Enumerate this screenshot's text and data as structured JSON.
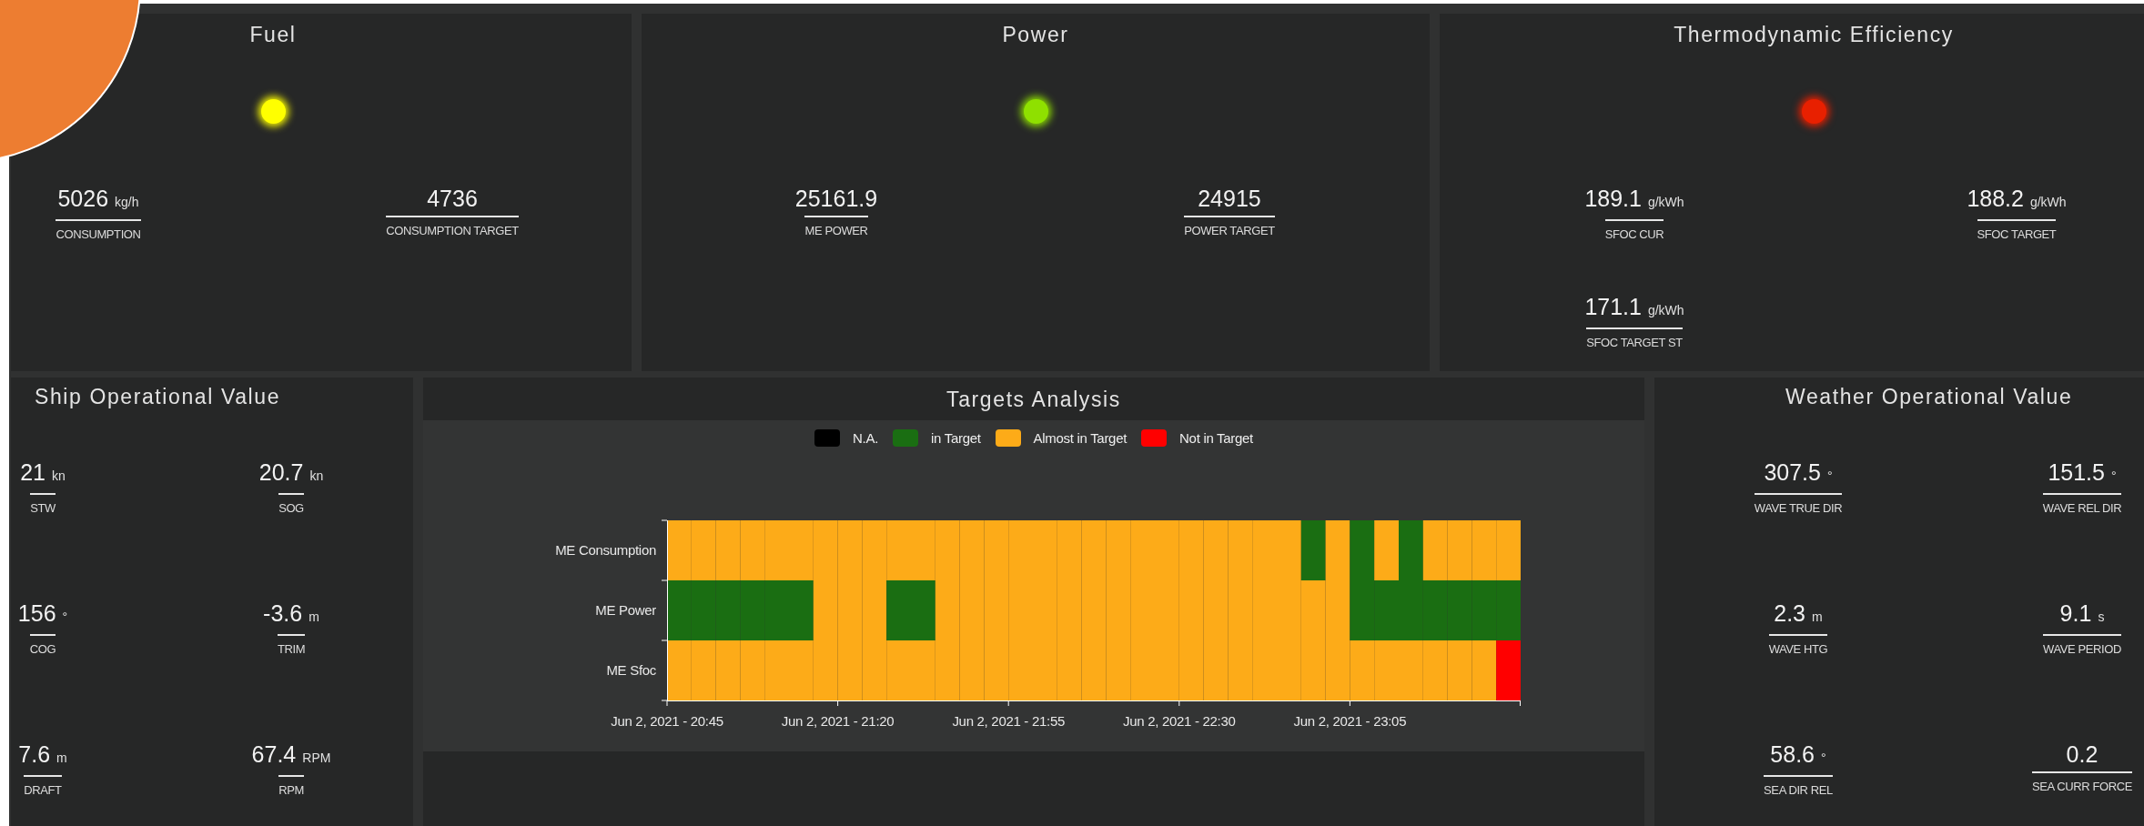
{
  "top_panels": [
    {
      "kind": "fuel",
      "title": "Fuel",
      "lamp": {
        "color": "#ffff00"
      },
      "metrics": [
        {
          "value": "5026",
          "unit": "kg/h",
          "label": "CONSUMPTION"
        },
        {
          "value": "4736",
          "label": "CONSUMPTION TARGET"
        }
      ]
    },
    {
      "kind": "power",
      "title": "Power",
      "lamp": {
        "color": "#8fe000"
      },
      "metrics": [
        {
          "value": "25161.9",
          "label": "ME POWER"
        },
        {
          "value": "24915",
          "label": "POWER TARGET"
        }
      ]
    },
    {
      "kind": "thermo",
      "title": "Thermodynamic Efficiency",
      "lamp": {
        "color": "#e82000"
      },
      "metrics": [
        {
          "value": "189.1",
          "unit": "g/kWh",
          "label": "SFOC CUR"
        },
        {
          "value": "188.2",
          "unit": "g/kWh",
          "label": "SFOC TARGET"
        },
        {
          "value": "171.1",
          "unit": "g/kWh",
          "label": "SFOC TARGET ST"
        }
      ]
    }
  ],
  "ship_operational": {
    "title": "Ship Operational Value",
    "metrics": [
      {
        "value": "21",
        "unit": "kn",
        "label": "STW"
      },
      {
        "value": "20.7",
        "unit": "kn",
        "label": "SOG"
      },
      {
        "value": "156",
        "unit": "°",
        "label": "COG"
      },
      {
        "value": "-3.6",
        "unit": "m",
        "label": "TRIM"
      },
      {
        "value": "7.6",
        "unit": "m",
        "label": "DRAFT"
      },
      {
        "value": "67.4",
        "unit": "RPM",
        "label": "RPM"
      }
    ]
  },
  "targets_analysis": {
    "title": "Targets Analysis",
    "legend": [
      {
        "label": "N.A.",
        "color": "#000000"
      },
      {
        "label": "in Target",
        "color": "#1a6e12"
      },
      {
        "label": "Almost in Target",
        "color": "#fdab18"
      },
      {
        "label": "Not in Target",
        "color": "#ff0000"
      }
    ],
    "rows": [
      {
        "label": "ME Consumption",
        "cells": [
          {
            "color": "#fdab18"
          },
          {
            "color": "#fdab18"
          },
          {
            "color": "#fdab18"
          },
          {
            "color": "#fdab18"
          },
          {
            "color": "#fdab18"
          },
          {
            "color": "#fdab18"
          },
          {
            "color": "#fdab18"
          },
          {
            "color": "#fdab18"
          },
          {
            "color": "#fdab18"
          },
          {
            "color": "#fdab18"
          },
          {
            "color": "#fdab18"
          },
          {
            "color": "#fdab18"
          },
          {
            "color": "#fdab18"
          },
          {
            "color": "#fdab18"
          },
          {
            "color": "#fdab18"
          },
          {
            "color": "#fdab18"
          },
          {
            "color": "#fdab18"
          },
          {
            "color": "#fdab18"
          },
          {
            "color": "#fdab18"
          },
          {
            "color": "#fdab18"
          },
          {
            "color": "#fdab18"
          },
          {
            "color": "#fdab18"
          },
          {
            "color": "#fdab18"
          },
          {
            "color": "#fdab18"
          },
          {
            "color": "#fdab18"
          },
          {
            "color": "#fdab18"
          },
          {
            "color": "#1a6e12"
          },
          {
            "color": "#fdab18"
          },
          {
            "color": "#1a6e12"
          },
          {
            "color": "#fdab18"
          },
          {
            "color": "#1a6e12"
          },
          {
            "color": "#fdab18"
          },
          {
            "color": "#fdab18"
          },
          {
            "color": "#fdab18"
          },
          {
            "color": "#fdab18"
          }
        ]
      },
      {
        "label": "ME Power",
        "cells": [
          {
            "color": "#1a6e12"
          },
          {
            "color": "#1a6e12"
          },
          {
            "color": "#1a6e12"
          },
          {
            "color": "#1a6e12"
          },
          {
            "color": "#1a6e12"
          },
          {
            "color": "#1a6e12"
          },
          {
            "color": "#fdab18"
          },
          {
            "color": "#fdab18"
          },
          {
            "color": "#fdab18"
          },
          {
            "color": "#1a6e12"
          },
          {
            "color": "#1a6e12"
          },
          {
            "color": "#fdab18"
          },
          {
            "color": "#fdab18"
          },
          {
            "color": "#fdab18"
          },
          {
            "color": "#fdab18"
          },
          {
            "color": "#fdab18"
          },
          {
            "color": "#fdab18"
          },
          {
            "color": "#fdab18"
          },
          {
            "color": "#fdab18"
          },
          {
            "color": "#fdab18"
          },
          {
            "color": "#fdab18"
          },
          {
            "color": "#fdab18"
          },
          {
            "color": "#fdab18"
          },
          {
            "color": "#fdab18"
          },
          {
            "color": "#fdab18"
          },
          {
            "color": "#fdab18"
          },
          {
            "color": "#fdab18"
          },
          {
            "color": "#fdab18"
          },
          {
            "color": "#1a6e12"
          },
          {
            "color": "#1a6e12"
          },
          {
            "color": "#1a6e12"
          },
          {
            "color": "#1a6e12"
          },
          {
            "color": "#1a6e12"
          },
          {
            "color": "#1a6e12"
          },
          {
            "color": "#1a6e12"
          }
        ]
      },
      {
        "label": "ME Sfoc",
        "cells": [
          {
            "color": "#fdab18"
          },
          {
            "color": "#fdab18"
          },
          {
            "color": "#fdab18"
          },
          {
            "color": "#fdab18"
          },
          {
            "color": "#fdab18"
          },
          {
            "color": "#fdab18"
          },
          {
            "color": "#fdab18"
          },
          {
            "color": "#fdab18"
          },
          {
            "color": "#fdab18"
          },
          {
            "color": "#fdab18"
          },
          {
            "color": "#fdab18"
          },
          {
            "color": "#fdab18"
          },
          {
            "color": "#fdab18"
          },
          {
            "color": "#fdab18"
          },
          {
            "color": "#fdab18"
          },
          {
            "color": "#fdab18"
          },
          {
            "color": "#fdab18"
          },
          {
            "color": "#fdab18"
          },
          {
            "color": "#fdab18"
          },
          {
            "color": "#fdab18"
          },
          {
            "color": "#fdab18"
          },
          {
            "color": "#fdab18"
          },
          {
            "color": "#fdab18"
          },
          {
            "color": "#fdab18"
          },
          {
            "color": "#fdab18"
          },
          {
            "color": "#fdab18"
          },
          {
            "color": "#fdab18"
          },
          {
            "color": "#fdab18"
          },
          {
            "color": "#fdab18"
          },
          {
            "color": "#fdab18"
          },
          {
            "color": "#fdab18"
          },
          {
            "color": "#fdab18"
          },
          {
            "color": "#fdab18"
          },
          {
            "color": "#fdab18"
          },
          {
            "color": "#ff0000"
          }
        ]
      }
    ],
    "x_ticks": [
      "Jun 2, 2021 - 20:45",
      "Jun 2, 2021 - 21:20",
      "Jun 2, 2021 - 21:55",
      "Jun 2, 2021 - 22:30",
      "Jun 2, 2021 - 23:05"
    ]
  },
  "weather_operational": {
    "title": "Weather Operational Value",
    "metrics": [
      {
        "value": "307.5",
        "unit": "°",
        "label": "WAVE TRUE DIR"
      },
      {
        "value": "151.5",
        "unit": "°",
        "label": "WAVE REL DIR"
      },
      {
        "value": "2.3",
        "unit": "m",
        "label": "WAVE HTG"
      },
      {
        "value": "9.1",
        "unit": "s",
        "label": "WAVE PERIOD"
      },
      {
        "value": "58.6",
        "unit": "°",
        "label": "SEA DIR REL"
      },
      {
        "value": "0.2",
        "label": "SEA CURR FORCE"
      }
    ]
  }
}
